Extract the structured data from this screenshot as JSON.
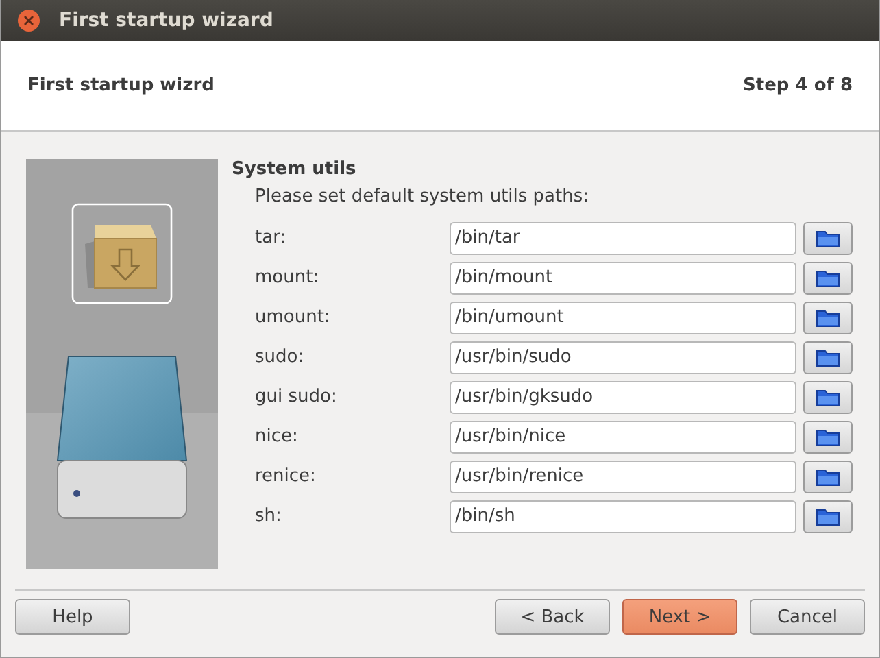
{
  "window": {
    "title": "First startup wizard"
  },
  "header": {
    "title": "First startup wizrd",
    "step": "Step 4 of 8"
  },
  "section": {
    "title": "System utils",
    "hint": "Please set default system utils paths:"
  },
  "fields": [
    {
      "label": "tar:",
      "value": "/bin/tar"
    },
    {
      "label": "mount:",
      "value": "/bin/mount"
    },
    {
      "label": "umount:",
      "value": "/bin/umount"
    },
    {
      "label": "sudo:",
      "value": "/usr/bin/sudo"
    },
    {
      "label": "gui sudo:",
      "value": "/usr/bin/gksudo"
    },
    {
      "label": "nice:",
      "value": "/usr/bin/nice"
    },
    {
      "label": "renice:",
      "value": "/usr/bin/renice"
    },
    {
      "label": "sh:",
      "value": "/bin/sh"
    }
  ],
  "buttons_left": [
    {
      "label": "Help",
      "default": false
    }
  ],
  "buttons_right": [
    {
      "label": "< Back",
      "default": false
    },
    {
      "label": "Next >",
      "default": true
    },
    {
      "label": "Cancel",
      "default": false
    }
  ]
}
